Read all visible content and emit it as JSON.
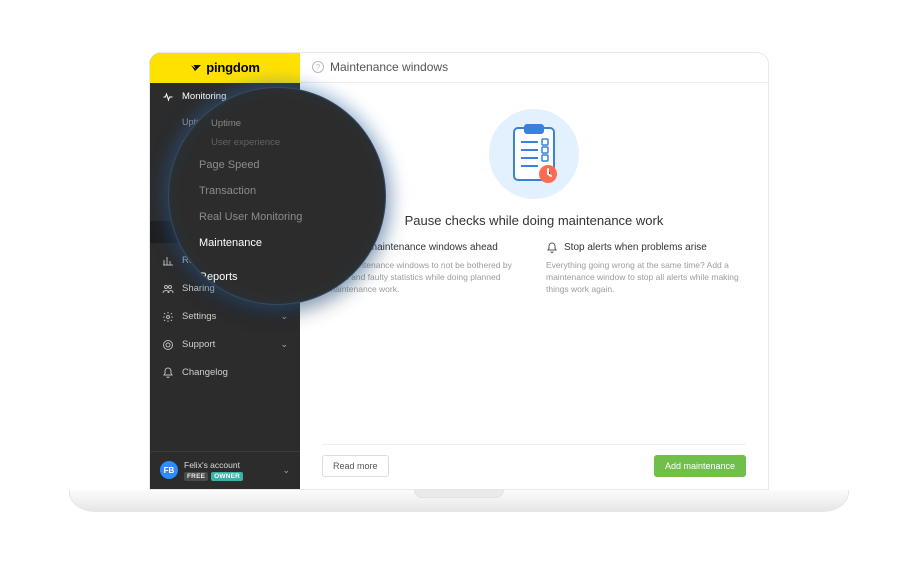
{
  "brand": {
    "name": "pingdom"
  },
  "sidebar": {
    "monitoring": {
      "label": "Monitoring",
      "items": [
        {
          "label": "Uptime"
        },
        {
          "label": "User experience"
        },
        {
          "label": "Page Speed"
        },
        {
          "label": "Transaction"
        },
        {
          "label": "Real User Monitoring"
        },
        {
          "label": "Maintenance"
        }
      ]
    },
    "reports": {
      "label": "Reports"
    },
    "sharing": {
      "label": "Sharing"
    },
    "settings": {
      "label": "Settings"
    },
    "support": {
      "label": "Support"
    },
    "changelog": {
      "label": "Changelog"
    }
  },
  "account": {
    "initials": "FB",
    "name": "Felix's account",
    "badges": {
      "free": "FREE",
      "owner": "OWNER"
    }
  },
  "page": {
    "title": "Maintenance windows",
    "heroTitle": "Pause checks while doing maintenance work",
    "col1": {
      "title": "Plan maintenance windows ahead",
      "desc": "Add maintenance windows to not be bothered by alerts and faulty statistics while doing planned maintenance work."
    },
    "col2": {
      "title": "Stop alerts when problems arise",
      "desc": "Everything going wrong at the same time? Add a maintenance window to stop all alerts while making things work again."
    },
    "buttons": {
      "readMore": "Read more",
      "addMaintenance": "Add maintenance"
    }
  },
  "magnifier": {
    "uptime": "Uptime",
    "ux": "User experience",
    "pageSpeed": "Page Speed",
    "transaction": "Transaction",
    "rum": "Real User Monitoring",
    "maintenance": "Maintenance",
    "reports": "Reports",
    "sharing": "Sharing"
  }
}
